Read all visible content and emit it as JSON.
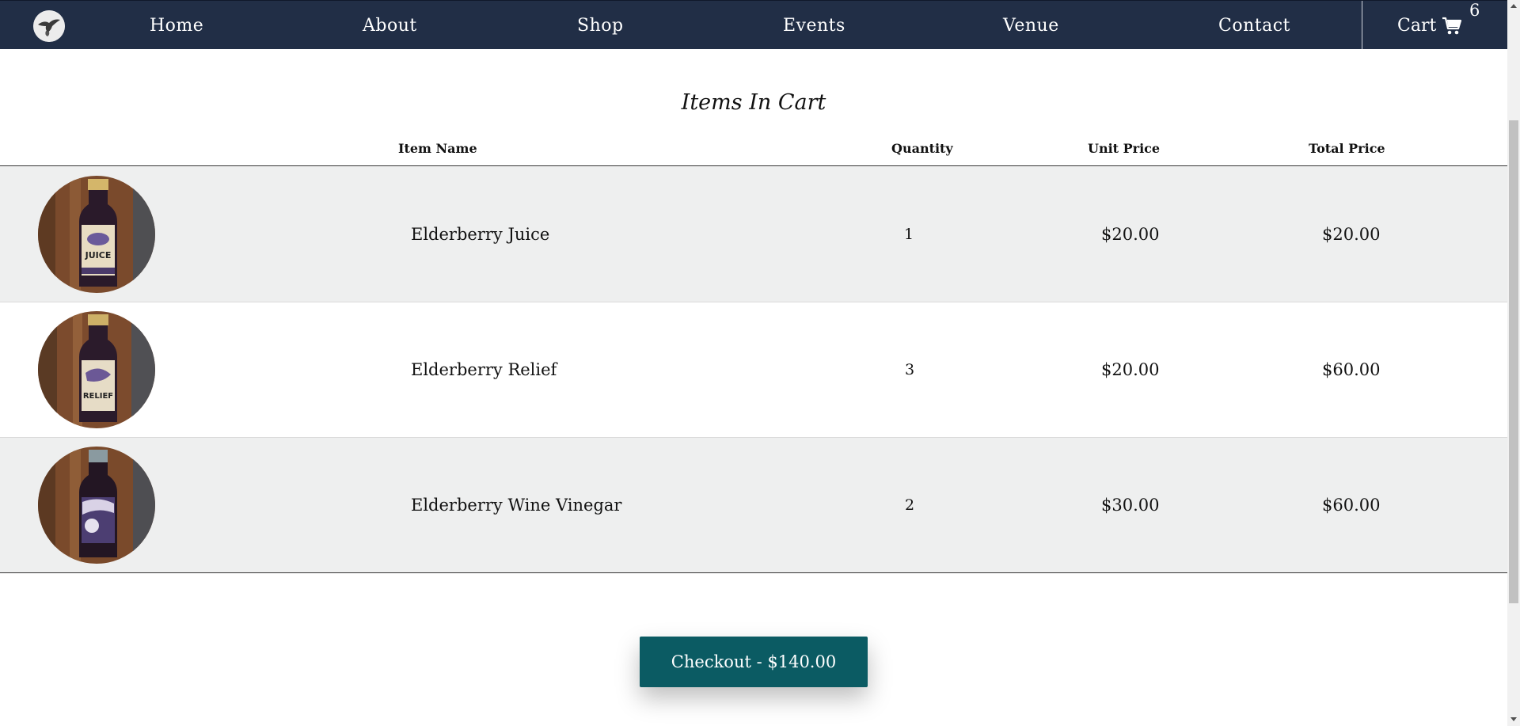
{
  "nav": {
    "items": [
      {
        "label": "Home"
      },
      {
        "label": "About"
      },
      {
        "label": "Shop"
      },
      {
        "label": "Events"
      },
      {
        "label": "Venue"
      },
      {
        "label": "Contact"
      }
    ],
    "cart_label": "Cart",
    "cart_count": "6",
    "logo_icon": "bird-logo-icon",
    "cart_icon": "shopping-cart-icon",
    "bar_color": "#212e46"
  },
  "cart": {
    "title": "Items In Cart",
    "columns": {
      "item_name": "Item Name",
      "quantity": "Quantity",
      "unit_price": "Unit Price",
      "total_price": "Total Price"
    },
    "items": [
      {
        "name": "Elderberry Juice",
        "quantity": "1",
        "unit_price": "$20.00",
        "total_price": "$20.00",
        "label_text": "JUICE"
      },
      {
        "name": "Elderberry Relief",
        "quantity": "3",
        "unit_price": "$20.00",
        "total_price": "$60.00",
        "label_text": "RELIEF"
      },
      {
        "name": "Elderberry Wine Vinegar",
        "quantity": "2",
        "unit_price": "$30.00",
        "total_price": "$60.00",
        "label_text": ""
      }
    ]
  },
  "checkout": {
    "label": "Checkout - $140.00",
    "color": "#0b5b63"
  }
}
